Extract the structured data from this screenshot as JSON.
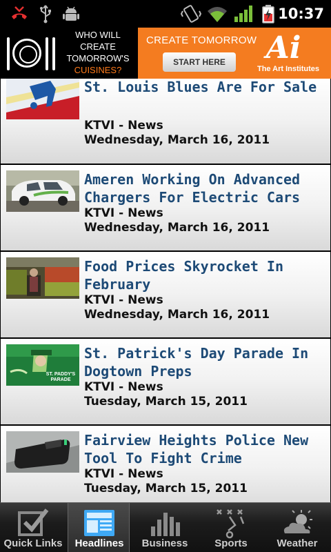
{
  "status_bar": {
    "time": "10:37",
    "icons": [
      "missed-call-icon",
      "usb-icon",
      "android-debug-icon",
      "vibrate-icon",
      "wifi-icon",
      "signal-icon",
      "battery-charging-icon"
    ]
  },
  "ad_banner": {
    "left_line1": "WHO WILL",
    "left_line2": "CREATE",
    "left_line3": "TOMORROW'S",
    "left_highlight": "CUISINES?",
    "right_headline": "CREATE TOMORROW",
    "button_label": "START HERE",
    "logo_mark": "Ai",
    "logo_text": "The Art Institutes"
  },
  "news": [
    {
      "title": "St. Louis Blues Are For Sale",
      "source": "KTVI - News",
      "date": "Wednesday, March 16, 2011",
      "thumb": "blues-logo-thumbnail"
    },
    {
      "title": "Ameren Working On Advanced Chargers For Electric Cars",
      "source": "KTVI - News",
      "date": "Wednesday, March 16, 2011",
      "thumb": "electric-car-thumbnail"
    },
    {
      "title": "Food Prices Skyrocket In February",
      "source": "KTVI - News",
      "date": "Wednesday, March 16, 2011",
      "thumb": "produce-market-thumbnail"
    },
    {
      "title": "St. Patrick's Day Parade In Dogtown Preps",
      "source": "KTVI - News",
      "date": "Tuesday, March 15, 2011",
      "thumb": "st-paddys-parade-thumbnail"
    },
    {
      "title": "Fairview Heights Police New Tool To Fight Crime",
      "source": "KTVI - News",
      "date": "Tuesday, March 15, 2011",
      "thumb": "police-device-thumbnail"
    }
  ],
  "thumb_badge": "ST. PADDY'S PARADE",
  "tabs": [
    {
      "label": "Quick Links",
      "icon": "checkbox-icon",
      "active": false
    },
    {
      "label": "Headlines",
      "icon": "newspaper-icon",
      "active": true
    },
    {
      "label": "Business",
      "icon": "bar-chart-icon",
      "active": false
    },
    {
      "label": "Sports",
      "icon": "playbook-icon",
      "active": false
    },
    {
      "label": "Weather",
      "icon": "cloud-sun-icon",
      "active": false
    }
  ],
  "colors": {
    "title_blue": "#1d4a76",
    "ad_orange": "#f47c20",
    "active_tab_icon": "#3fa9f5"
  }
}
